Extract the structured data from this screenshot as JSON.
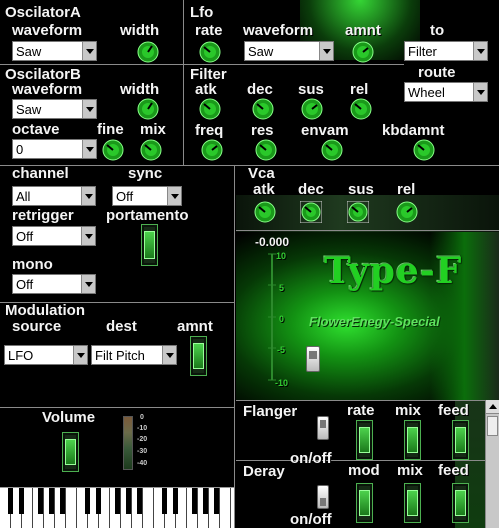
{
  "oscA": {
    "title": "OscilatorA",
    "waveform_label": "waveform",
    "width_label": "width",
    "waveform_value": "Saw"
  },
  "lfo": {
    "title": "Lfo",
    "rate_label": "rate",
    "waveform_label": "waveform",
    "amnt_label": "amnt",
    "to_label": "to",
    "waveform_value": "Saw",
    "to_value": "Filter"
  },
  "oscB": {
    "title": "OscilatorB",
    "waveform_label": "waveform",
    "width_label": "width",
    "waveform_value": "Saw",
    "octave_label": "octave",
    "fine_label": "fine",
    "mix_label": "mix",
    "octave_value": "0"
  },
  "filter": {
    "title": "Filter",
    "atk": "atk",
    "dec": "dec",
    "sus": "sus",
    "rel": "rel",
    "freq": "freq",
    "res": "res",
    "envam": "envam",
    "kbdamnt": "kbdamnt",
    "route_label": "route",
    "route_value": "Wheel"
  },
  "voice": {
    "channel_label": "channel",
    "channel_value": "All",
    "sync_label": "sync",
    "sync_value": "Off",
    "retrigger_label": "retrigger",
    "retrigger_value": "Off",
    "portamento_label": "portamento",
    "mono_label": "mono",
    "mono_value": "Off"
  },
  "vca": {
    "title": "Vca",
    "atk": "atk",
    "dec": "dec",
    "sus": "sus",
    "rel": "rel"
  },
  "display": {
    "readout": "-0.000",
    "scale": [
      "10",
      "5",
      "0",
      "-5",
      "-10"
    ],
    "brand": "Type-F",
    "subtitle": "FlowerEnegy-Special"
  },
  "modulation": {
    "title": "Modulation",
    "source_label": "source",
    "dest_label": "dest",
    "amnt_label": "amnt",
    "source_value": "LFO",
    "dest_value": "Filt Pitch"
  },
  "volume": {
    "title": "Volume",
    "meter_scale": [
      "0",
      "-10",
      "-20",
      "-30",
      "-40"
    ]
  },
  "flanger": {
    "title": "Flanger",
    "rate": "rate",
    "mix": "mix",
    "feed": "feed",
    "onoff": "on/off"
  },
  "delay": {
    "title": "Deray",
    "mod": "mod",
    "mix": "mix",
    "feed": "feed",
    "onoff": "on/off"
  },
  "colors": {
    "accent": "#2fd12f",
    "background": "#000000"
  }
}
